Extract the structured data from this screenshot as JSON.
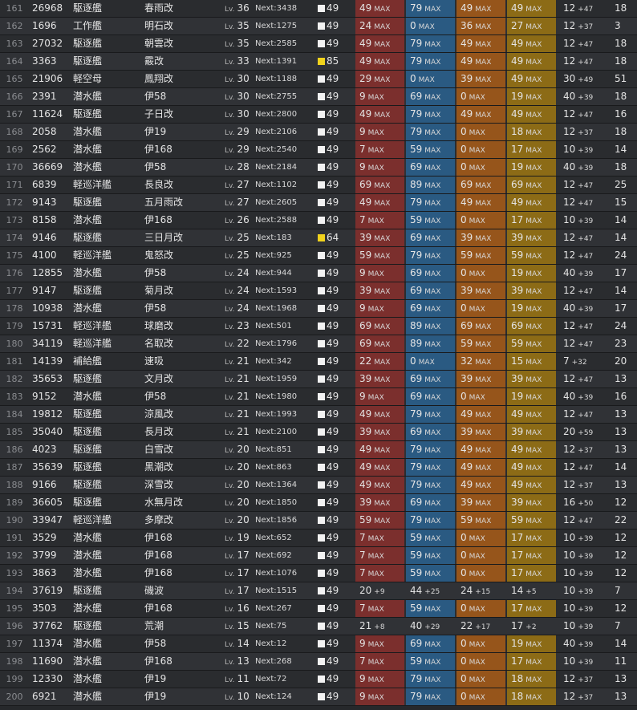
{
  "labels": {
    "lv": "Lv.",
    "next": "Next:",
    "max": "MAX"
  },
  "colors": {
    "firepower_max": "#7b2f2d",
    "torpedo_max": "#2a5a82",
    "antiair_max": "#96551b",
    "armor_max": "#8c6b16",
    "cond_normal": "#f2f2f2",
    "cond_sparkled": "#f1d31d"
  },
  "rows": [
    {
      "no": "161",
      "id": "26968",
      "type": "駆逐艦",
      "name": "春雨改",
      "lv": "36",
      "next": "Next:3438",
      "cond": "49",
      "cond_icon": "white-box",
      "fp": "49",
      "fp_s": "MAX",
      "tp": "79",
      "tp_s": "MAX",
      "aa": "49",
      "aa_s": "MAX",
      "ar": "49",
      "ar_s": "MAX",
      "lk": "12",
      "lk_s": "+47",
      "eva": "18"
    },
    {
      "no": "162",
      "id": "1696",
      "type": "工作艦",
      "name": "明石改",
      "lv": "35",
      "next": "Next:1275",
      "cond": "49",
      "cond_icon": "white-box",
      "fp": "24",
      "fp_s": "MAX",
      "tp": "0",
      "tp_s": "MAX",
      "aa": "36",
      "aa_s": "MAX",
      "ar": "27",
      "ar_s": "MAX",
      "lk": "12",
      "lk_s": "+37",
      "eva": "3"
    },
    {
      "no": "163",
      "id": "27032",
      "type": "駆逐艦",
      "name": "朝雲改",
      "lv": "35",
      "next": "Next:2585",
      "cond": "49",
      "cond_icon": "white-box",
      "fp": "49",
      "fp_s": "MAX",
      "tp": "79",
      "tp_s": "MAX",
      "aa": "49",
      "aa_s": "MAX",
      "ar": "49",
      "ar_s": "MAX",
      "lk": "12",
      "lk_s": "+47",
      "eva": "18"
    },
    {
      "no": "164",
      "id": "3363",
      "type": "駆逐艦",
      "name": "霰改",
      "lv": "33",
      "next": "Next:1391",
      "cond": "85",
      "cond_icon": "yellow-box",
      "fp": "49",
      "fp_s": "MAX",
      "tp": "79",
      "tp_s": "MAX",
      "aa": "49",
      "aa_s": "MAX",
      "ar": "49",
      "ar_s": "MAX",
      "lk": "12",
      "lk_s": "+47",
      "eva": "18"
    },
    {
      "no": "165",
      "id": "21906",
      "type": "軽空母",
      "name": "鳳翔改",
      "lv": "30",
      "next": "Next:1188",
      "cond": "49",
      "cond_icon": "white-box",
      "fp": "29",
      "fp_s": "MAX",
      "tp": "0",
      "tp_s": "MAX",
      "aa": "39",
      "aa_s": "MAX",
      "ar": "49",
      "ar_s": "MAX",
      "lk": "30",
      "lk_s": "+49",
      "eva": "51"
    },
    {
      "no": "166",
      "id": "2391",
      "type": "潜水艦",
      "name": "伊58",
      "lv": "30",
      "next": "Next:2755",
      "cond": "49",
      "cond_icon": "white-box",
      "fp": "9",
      "fp_s": "MAX",
      "tp": "69",
      "tp_s": "MAX",
      "aa": "0",
      "aa_s": "MAX",
      "ar": "19",
      "ar_s": "MAX",
      "lk": "40",
      "lk_s": "+39",
      "eva": "18"
    },
    {
      "no": "167",
      "id": "11624",
      "type": "駆逐艦",
      "name": "子日改",
      "lv": "30",
      "next": "Next:2800",
      "cond": "49",
      "cond_icon": "white-box",
      "fp": "49",
      "fp_s": "MAX",
      "tp": "79",
      "tp_s": "MAX",
      "aa": "49",
      "aa_s": "MAX",
      "ar": "49",
      "ar_s": "MAX",
      "lk": "12",
      "lk_s": "+47",
      "eva": "16"
    },
    {
      "no": "168",
      "id": "2058",
      "type": "潜水艦",
      "name": "伊19",
      "lv": "29",
      "next": "Next:2106",
      "cond": "49",
      "cond_icon": "white-box",
      "fp": "9",
      "fp_s": "MAX",
      "tp": "79",
      "tp_s": "MAX",
      "aa": "0",
      "aa_s": "MAX",
      "ar": "18",
      "ar_s": "MAX",
      "lk": "12",
      "lk_s": "+37",
      "eva": "18"
    },
    {
      "no": "169",
      "id": "2562",
      "type": "潜水艦",
      "name": "伊168",
      "lv": "29",
      "next": "Next:2540",
      "cond": "49",
      "cond_icon": "white-box",
      "fp": "7",
      "fp_s": "MAX",
      "tp": "59",
      "tp_s": "MAX",
      "aa": "0",
      "aa_s": "MAX",
      "ar": "17",
      "ar_s": "MAX",
      "lk": "10",
      "lk_s": "+39",
      "eva": "14"
    },
    {
      "no": "170",
      "id": "36669",
      "type": "潜水艦",
      "name": "伊58",
      "lv": "28",
      "next": "Next:2184",
      "cond": "49",
      "cond_icon": "white-box",
      "fp": "9",
      "fp_s": "MAX",
      "tp": "69",
      "tp_s": "MAX",
      "aa": "0",
      "aa_s": "MAX",
      "ar": "19",
      "ar_s": "MAX",
      "lk": "40",
      "lk_s": "+39",
      "eva": "18"
    },
    {
      "no": "171",
      "id": "6839",
      "type": "軽巡洋艦",
      "name": "長良改",
      "lv": "27",
      "next": "Next:1102",
      "cond": "49",
      "cond_icon": "white-box",
      "fp": "69",
      "fp_s": "MAX",
      "tp": "89",
      "tp_s": "MAX",
      "aa": "69",
      "aa_s": "MAX",
      "ar": "69",
      "ar_s": "MAX",
      "lk": "12",
      "lk_s": "+47",
      "eva": "25"
    },
    {
      "no": "172",
      "id": "9143",
      "type": "駆逐艦",
      "name": "五月雨改",
      "lv": "27",
      "next": "Next:2605",
      "cond": "49",
      "cond_icon": "white-box",
      "fp": "49",
      "fp_s": "MAX",
      "tp": "79",
      "tp_s": "MAX",
      "aa": "49",
      "aa_s": "MAX",
      "ar": "49",
      "ar_s": "MAX",
      "lk": "12",
      "lk_s": "+47",
      "eva": "15"
    },
    {
      "no": "173",
      "id": "8158",
      "type": "潜水艦",
      "name": "伊168",
      "lv": "26",
      "next": "Next:2588",
      "cond": "49",
      "cond_icon": "white-box",
      "fp": "7",
      "fp_s": "MAX",
      "tp": "59",
      "tp_s": "MAX",
      "aa": "0",
      "aa_s": "MAX",
      "ar": "17",
      "ar_s": "MAX",
      "lk": "10",
      "lk_s": "+39",
      "eva": "14"
    },
    {
      "no": "174",
      "id": "9146",
      "type": "駆逐艦",
      "name": "三日月改",
      "lv": "25",
      "next": "Next:183",
      "cond": "64",
      "cond_icon": "yellow-box",
      "fp": "39",
      "fp_s": "MAX",
      "tp": "69",
      "tp_s": "MAX",
      "aa": "39",
      "aa_s": "MAX",
      "ar": "39",
      "ar_s": "MAX",
      "lk": "12",
      "lk_s": "+47",
      "eva": "14"
    },
    {
      "no": "175",
      "id": "4100",
      "type": "軽巡洋艦",
      "name": "鬼怒改",
      "lv": "25",
      "next": "Next:925",
      "cond": "49",
      "cond_icon": "white-box",
      "fp": "59",
      "fp_s": "MAX",
      "tp": "79",
      "tp_s": "MAX",
      "aa": "59",
      "aa_s": "MAX",
      "ar": "59",
      "ar_s": "MAX",
      "lk": "12",
      "lk_s": "+47",
      "eva": "24"
    },
    {
      "no": "176",
      "id": "12855",
      "type": "潜水艦",
      "name": "伊58",
      "lv": "24",
      "next": "Next:944",
      "cond": "49",
      "cond_icon": "white-box",
      "fp": "9",
      "fp_s": "MAX",
      "tp": "69",
      "tp_s": "MAX",
      "aa": "0",
      "aa_s": "MAX",
      "ar": "19",
      "ar_s": "MAX",
      "lk": "40",
      "lk_s": "+39",
      "eva": "17"
    },
    {
      "no": "177",
      "id": "9147",
      "type": "駆逐艦",
      "name": "菊月改",
      "lv": "24",
      "next": "Next:1593",
      "cond": "49",
      "cond_icon": "white-box",
      "fp": "39",
      "fp_s": "MAX",
      "tp": "69",
      "tp_s": "MAX",
      "aa": "39",
      "aa_s": "MAX",
      "ar": "39",
      "ar_s": "MAX",
      "lk": "12",
      "lk_s": "+47",
      "eva": "14"
    },
    {
      "no": "178",
      "id": "10938",
      "type": "潜水艦",
      "name": "伊58",
      "lv": "24",
      "next": "Next:1968",
      "cond": "49",
      "cond_icon": "white-box",
      "fp": "9",
      "fp_s": "MAX",
      "tp": "69",
      "tp_s": "MAX",
      "aa": "0",
      "aa_s": "MAX",
      "ar": "19",
      "ar_s": "MAX",
      "lk": "40",
      "lk_s": "+39",
      "eva": "17"
    },
    {
      "no": "179",
      "id": "15731",
      "type": "軽巡洋艦",
      "name": "球磨改",
      "lv": "23",
      "next": "Next:501",
      "cond": "49",
      "cond_icon": "white-box",
      "fp": "69",
      "fp_s": "MAX",
      "tp": "89",
      "tp_s": "MAX",
      "aa": "69",
      "aa_s": "MAX",
      "ar": "69",
      "ar_s": "MAX",
      "lk": "12",
      "lk_s": "+47",
      "eva": "24"
    },
    {
      "no": "180",
      "id": "34119",
      "type": "軽巡洋艦",
      "name": "名取改",
      "lv": "22",
      "next": "Next:1796",
      "cond": "49",
      "cond_icon": "white-box",
      "fp": "69",
      "fp_s": "MAX",
      "tp": "89",
      "tp_s": "MAX",
      "aa": "59",
      "aa_s": "MAX",
      "ar": "59",
      "ar_s": "MAX",
      "lk": "12",
      "lk_s": "+47",
      "eva": "23"
    },
    {
      "no": "181",
      "id": "14139",
      "type": "補給艦",
      "name": "速吸",
      "lv": "21",
      "next": "Next:342",
      "cond": "49",
      "cond_icon": "white-box",
      "fp": "22",
      "fp_s": "MAX",
      "tp": "0",
      "tp_s": "MAX",
      "aa": "32",
      "aa_s": "MAX",
      "ar": "15",
      "ar_s": "MAX",
      "lk": "7",
      "lk_s": "+32",
      "eva": "20"
    },
    {
      "no": "182",
      "id": "35653",
      "type": "駆逐艦",
      "name": "文月改",
      "lv": "21",
      "next": "Next:1959",
      "cond": "49",
      "cond_icon": "white-box",
      "fp": "39",
      "fp_s": "MAX",
      "tp": "69",
      "tp_s": "MAX",
      "aa": "39",
      "aa_s": "MAX",
      "ar": "39",
      "ar_s": "MAX",
      "lk": "12",
      "lk_s": "+47",
      "eva": "13"
    },
    {
      "no": "183",
      "id": "9152",
      "type": "潜水艦",
      "name": "伊58",
      "lv": "21",
      "next": "Next:1980",
      "cond": "49",
      "cond_icon": "white-box",
      "fp": "9",
      "fp_s": "MAX",
      "tp": "69",
      "tp_s": "MAX",
      "aa": "0",
      "aa_s": "MAX",
      "ar": "19",
      "ar_s": "MAX",
      "lk": "40",
      "lk_s": "+39",
      "eva": "16"
    },
    {
      "no": "184",
      "id": "19812",
      "type": "駆逐艦",
      "name": "涼風改",
      "lv": "21",
      "next": "Next:1993",
      "cond": "49",
      "cond_icon": "white-box",
      "fp": "49",
      "fp_s": "MAX",
      "tp": "79",
      "tp_s": "MAX",
      "aa": "49",
      "aa_s": "MAX",
      "ar": "49",
      "ar_s": "MAX",
      "lk": "12",
      "lk_s": "+47",
      "eva": "13"
    },
    {
      "no": "185",
      "id": "35040",
      "type": "駆逐艦",
      "name": "長月改",
      "lv": "21",
      "next": "Next:2100",
      "cond": "49",
      "cond_icon": "white-box",
      "fp": "39",
      "fp_s": "MAX",
      "tp": "69",
      "tp_s": "MAX",
      "aa": "39",
      "aa_s": "MAX",
      "ar": "39",
      "ar_s": "MAX",
      "lk": "20",
      "lk_s": "+59",
      "eva": "13"
    },
    {
      "no": "186",
      "id": "4023",
      "type": "駆逐艦",
      "name": "白雪改",
      "lv": "20",
      "next": "Next:851",
      "cond": "49",
      "cond_icon": "white-box",
      "fp": "49",
      "fp_s": "MAX",
      "tp": "79",
      "tp_s": "MAX",
      "aa": "49",
      "aa_s": "MAX",
      "ar": "49",
      "ar_s": "MAX",
      "lk": "12",
      "lk_s": "+37",
      "eva": "13"
    },
    {
      "no": "187",
      "id": "35639",
      "type": "駆逐艦",
      "name": "黒潮改",
      "lv": "20",
      "next": "Next:863",
      "cond": "49",
      "cond_icon": "white-box",
      "fp": "49",
      "fp_s": "MAX",
      "tp": "79",
      "tp_s": "MAX",
      "aa": "49",
      "aa_s": "MAX",
      "ar": "49",
      "ar_s": "MAX",
      "lk": "12",
      "lk_s": "+47",
      "eva": "14"
    },
    {
      "no": "188",
      "id": "9166",
      "type": "駆逐艦",
      "name": "深雪改",
      "lv": "20",
      "next": "Next:1364",
      "cond": "49",
      "cond_icon": "white-box",
      "fp": "49",
      "fp_s": "MAX",
      "tp": "79",
      "tp_s": "MAX",
      "aa": "49",
      "aa_s": "MAX",
      "ar": "49",
      "ar_s": "MAX",
      "lk": "12",
      "lk_s": "+37",
      "eva": "13"
    },
    {
      "no": "189",
      "id": "36605",
      "type": "駆逐艦",
      "name": "水無月改",
      "lv": "20",
      "next": "Next:1850",
      "cond": "49",
      "cond_icon": "white-box",
      "fp": "39",
      "fp_s": "MAX",
      "tp": "69",
      "tp_s": "MAX",
      "aa": "39",
      "aa_s": "MAX",
      "ar": "39",
      "ar_s": "MAX",
      "lk": "16",
      "lk_s": "+50",
      "eva": "12"
    },
    {
      "no": "190",
      "id": "33947",
      "type": "軽巡洋艦",
      "name": "多摩改",
      "lv": "20",
      "next": "Next:1856",
      "cond": "49",
      "cond_icon": "white-box",
      "fp": "59",
      "fp_s": "MAX",
      "tp": "79",
      "tp_s": "MAX",
      "aa": "59",
      "aa_s": "MAX",
      "ar": "59",
      "ar_s": "MAX",
      "lk": "12",
      "lk_s": "+47",
      "eva": "22"
    },
    {
      "no": "191",
      "id": "3529",
      "type": "潜水艦",
      "name": "伊168",
      "lv": "19",
      "next": "Next:652",
      "cond": "49",
      "cond_icon": "white-box",
      "fp": "7",
      "fp_s": "MAX",
      "tp": "59",
      "tp_s": "MAX",
      "aa": "0",
      "aa_s": "MAX",
      "ar": "17",
      "ar_s": "MAX",
      "lk": "10",
      "lk_s": "+39",
      "eva": "12"
    },
    {
      "no": "192",
      "id": "3799",
      "type": "潜水艦",
      "name": "伊168",
      "lv": "17",
      "next": "Next:692",
      "cond": "49",
      "cond_icon": "white-box",
      "fp": "7",
      "fp_s": "MAX",
      "tp": "59",
      "tp_s": "MAX",
      "aa": "0",
      "aa_s": "MAX",
      "ar": "17",
      "ar_s": "MAX",
      "lk": "10",
      "lk_s": "+39",
      "eva": "12"
    },
    {
      "no": "193",
      "id": "3863",
      "type": "潜水艦",
      "name": "伊168",
      "lv": "17",
      "next": "Next:1076",
      "cond": "49",
      "cond_icon": "white-box",
      "fp": "7",
      "fp_s": "MAX",
      "tp": "59",
      "tp_s": "MAX",
      "aa": "0",
      "aa_s": "MAX",
      "ar": "17",
      "ar_s": "MAX",
      "lk": "10",
      "lk_s": "+39",
      "eva": "12"
    },
    {
      "no": "194",
      "id": "37619",
      "type": "駆逐艦",
      "name": "磯波",
      "lv": "17",
      "next": "Next:1515",
      "cond": "49",
      "cond_icon": "white-box",
      "fp": "20",
      "fp_s": "+9",
      "tp": "44",
      "tp_s": "+25",
      "aa": "24",
      "aa_s": "+15",
      "ar": "14",
      "ar_s": "+5",
      "lk": "10",
      "lk_s": "+39",
      "eva": "7"
    },
    {
      "no": "195",
      "id": "3503",
      "type": "潜水艦",
      "name": "伊168",
      "lv": "16",
      "next": "Next:267",
      "cond": "49",
      "cond_icon": "white-box",
      "fp": "7",
      "fp_s": "MAX",
      "tp": "59",
      "tp_s": "MAX",
      "aa": "0",
      "aa_s": "MAX",
      "ar": "17",
      "ar_s": "MAX",
      "lk": "10",
      "lk_s": "+39",
      "eva": "12"
    },
    {
      "no": "196",
      "id": "37762",
      "type": "駆逐艦",
      "name": "荒潮",
      "lv": "15",
      "next": "Next:75",
      "cond": "49",
      "cond_icon": "white-box",
      "fp": "21",
      "fp_s": "+8",
      "tp": "40",
      "tp_s": "+29",
      "aa": "22",
      "aa_s": "+17",
      "ar": "17",
      "ar_s": "+2",
      "lk": "10",
      "lk_s": "+39",
      "eva": "7"
    },
    {
      "no": "197",
      "id": "11374",
      "type": "潜水艦",
      "name": "伊58",
      "lv": "14",
      "next": "Next:12",
      "cond": "49",
      "cond_icon": "white-box",
      "fp": "9",
      "fp_s": "MAX",
      "tp": "69",
      "tp_s": "MAX",
      "aa": "0",
      "aa_s": "MAX",
      "ar": "19",
      "ar_s": "MAX",
      "lk": "40",
      "lk_s": "+39",
      "eva": "14"
    },
    {
      "no": "198",
      "id": "11690",
      "type": "潜水艦",
      "name": "伊168",
      "lv": "13",
      "next": "Next:268",
      "cond": "49",
      "cond_icon": "white-box",
      "fp": "7",
      "fp_s": "MAX",
      "tp": "59",
      "tp_s": "MAX",
      "aa": "0",
      "aa_s": "MAX",
      "ar": "17",
      "ar_s": "MAX",
      "lk": "10",
      "lk_s": "+39",
      "eva": "11"
    },
    {
      "no": "199",
      "id": "12330",
      "type": "潜水艦",
      "name": "伊19",
      "lv": "11",
      "next": "Next:72",
      "cond": "49",
      "cond_icon": "white-box",
      "fp": "9",
      "fp_s": "MAX",
      "tp": "79",
      "tp_s": "MAX",
      "aa": "0",
      "aa_s": "MAX",
      "ar": "18",
      "ar_s": "MAX",
      "lk": "12",
      "lk_s": "+37",
      "eva": "13"
    },
    {
      "no": "200",
      "id": "6921",
      "type": "潜水艦",
      "name": "伊19",
      "lv": "10",
      "next": "Next:124",
      "cond": "49",
      "cond_icon": "white-box",
      "fp": "9",
      "fp_s": "MAX",
      "tp": "79",
      "tp_s": "MAX",
      "aa": "0",
      "aa_s": "MAX",
      "ar": "18",
      "ar_s": "MAX",
      "lk": "12",
      "lk_s": "+37",
      "eva": "13"
    }
  ]
}
